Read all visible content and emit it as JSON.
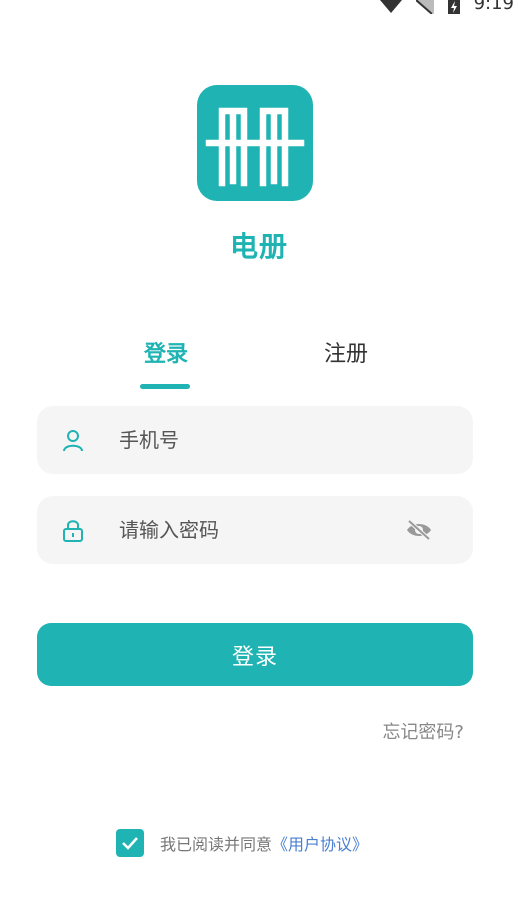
{
  "status_bar": {
    "time": "9:19",
    "icons": [
      "wifi-icon",
      "signal-icon",
      "battery-charging-icon"
    ]
  },
  "app": {
    "name": "电册",
    "logo_text": "册"
  },
  "tabs": {
    "login": "登录",
    "register": "注册"
  },
  "form": {
    "phone_placeholder": "手机号",
    "password_placeholder": "请输入密码"
  },
  "buttons": {
    "login": "登录",
    "forgot_password": "忘记密码?"
  },
  "agreement": {
    "checked": true,
    "text": "我已阅读并同意",
    "link": "《用户协议》"
  },
  "colors": {
    "accent": "#1fb3b3",
    "field_bg": "#f5f5f5",
    "link": "#4a7fd0"
  }
}
